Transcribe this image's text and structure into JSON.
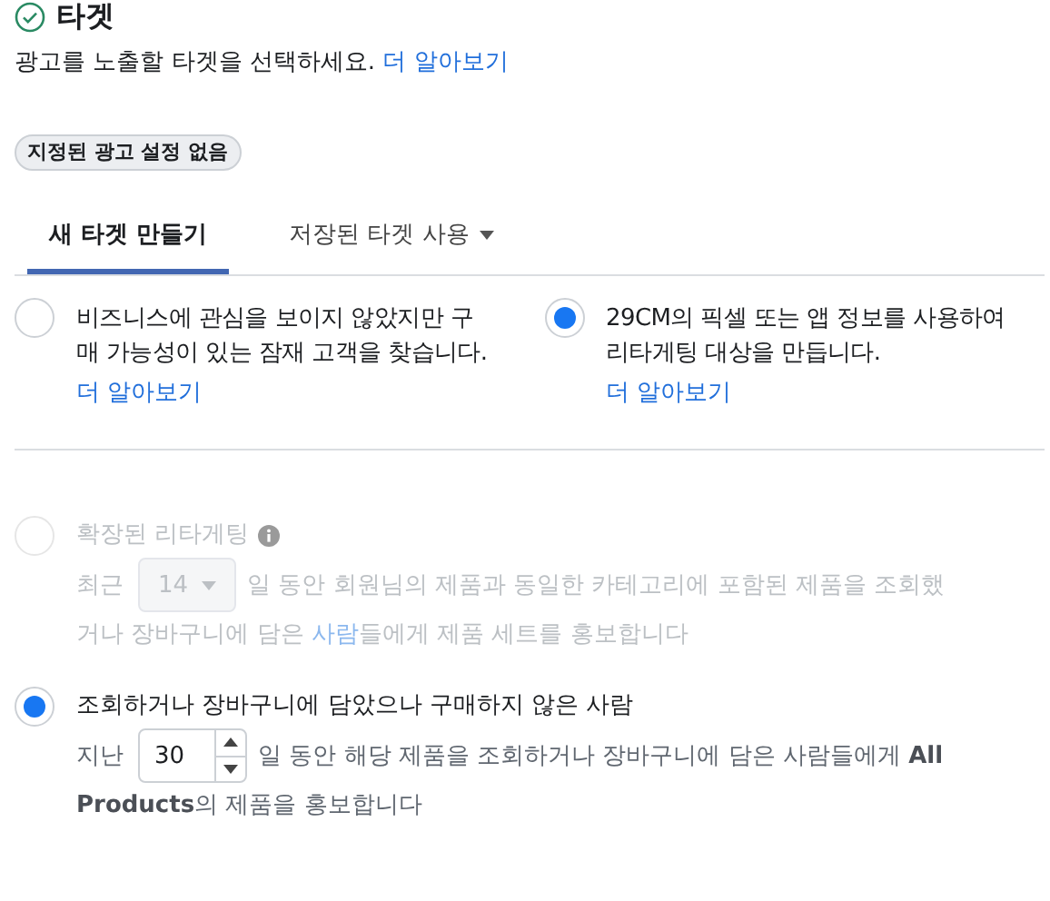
{
  "section": {
    "title": "타겟",
    "complete": true,
    "description": "광고를 노출할 타겟을 선택하세요.",
    "link": "더 알아보기"
  },
  "badge": "지정된 광고 설정 없음",
  "tabs": [
    {
      "label": "새 타겟 만들기",
      "selected": true,
      "dropdown": false
    },
    {
      "label": "저장된 타겟 사용",
      "selected": false,
      "dropdown": true
    }
  ],
  "audience_options": [
    {
      "text": "비즈니스에 관심을 보이지 않았지만 구매 가능성이 있는 잠재 고객을 찾습니다.",
      "link": "더 알아보기",
      "selected": false
    },
    {
      "text": "29CM의 픽셀 또는 앱 정보를 사용하여 리타게팅 대상을 만듭니다.",
      "link": "더 알아보기",
      "selected": true
    }
  ],
  "retargeting_options": [
    {
      "kind": "dropdown",
      "title": "확장된 리타게팅",
      "info": true,
      "selected": false,
      "disabled": true,
      "prefix": "최근",
      "value": "14",
      "text": "일 동안 회원님의 제품과 동일한 카테고리에 포함된 제품을 조회했",
      "line_2": "거나 장바구니에 담은 ",
      "link": "사람",
      "text_after_link": "들에게 제품 세트를 홍보합니다"
    },
    {
      "kind": "spinner",
      "title": "조회하거나 장바구니에 담았으나 구매하지 않은 사람",
      "info": false,
      "selected": true,
      "disabled": false,
      "prefix": "지난",
      "value": "30",
      "text": "일 동안 해당 제품을 조회하거나 장바구니에 담은 사람들에게 **All**",
      "line_2": "**Products**의 제품을 홍보합니다"
    }
  ]
}
